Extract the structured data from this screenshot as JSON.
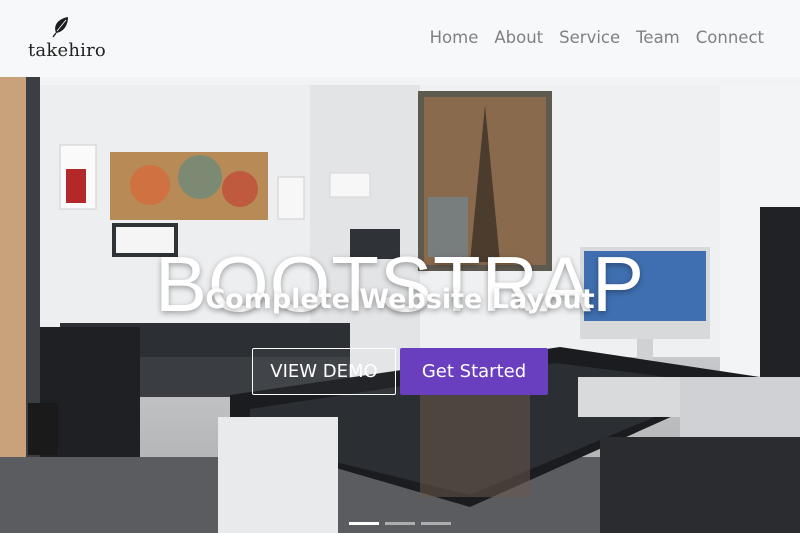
{
  "brand": {
    "name": "takehiro",
    "logo_icon": "leaf-icon"
  },
  "nav": {
    "items": [
      {
        "label": "Home"
      },
      {
        "label": "About"
      },
      {
        "label": "Service"
      },
      {
        "label": "Team"
      },
      {
        "label": "Connect"
      }
    ]
  },
  "hero": {
    "title": "BOOTSTRAP",
    "subtitle": "Complete Website Layout",
    "demo_button": "VIEW DEMO",
    "start_button": "Get Started",
    "carousel": {
      "slide_count": 3,
      "active_slide": 1
    }
  },
  "colors": {
    "accent": "#6a3fbf",
    "nav_text": "#808080",
    "navbar_bg": "#f7f8fa"
  }
}
